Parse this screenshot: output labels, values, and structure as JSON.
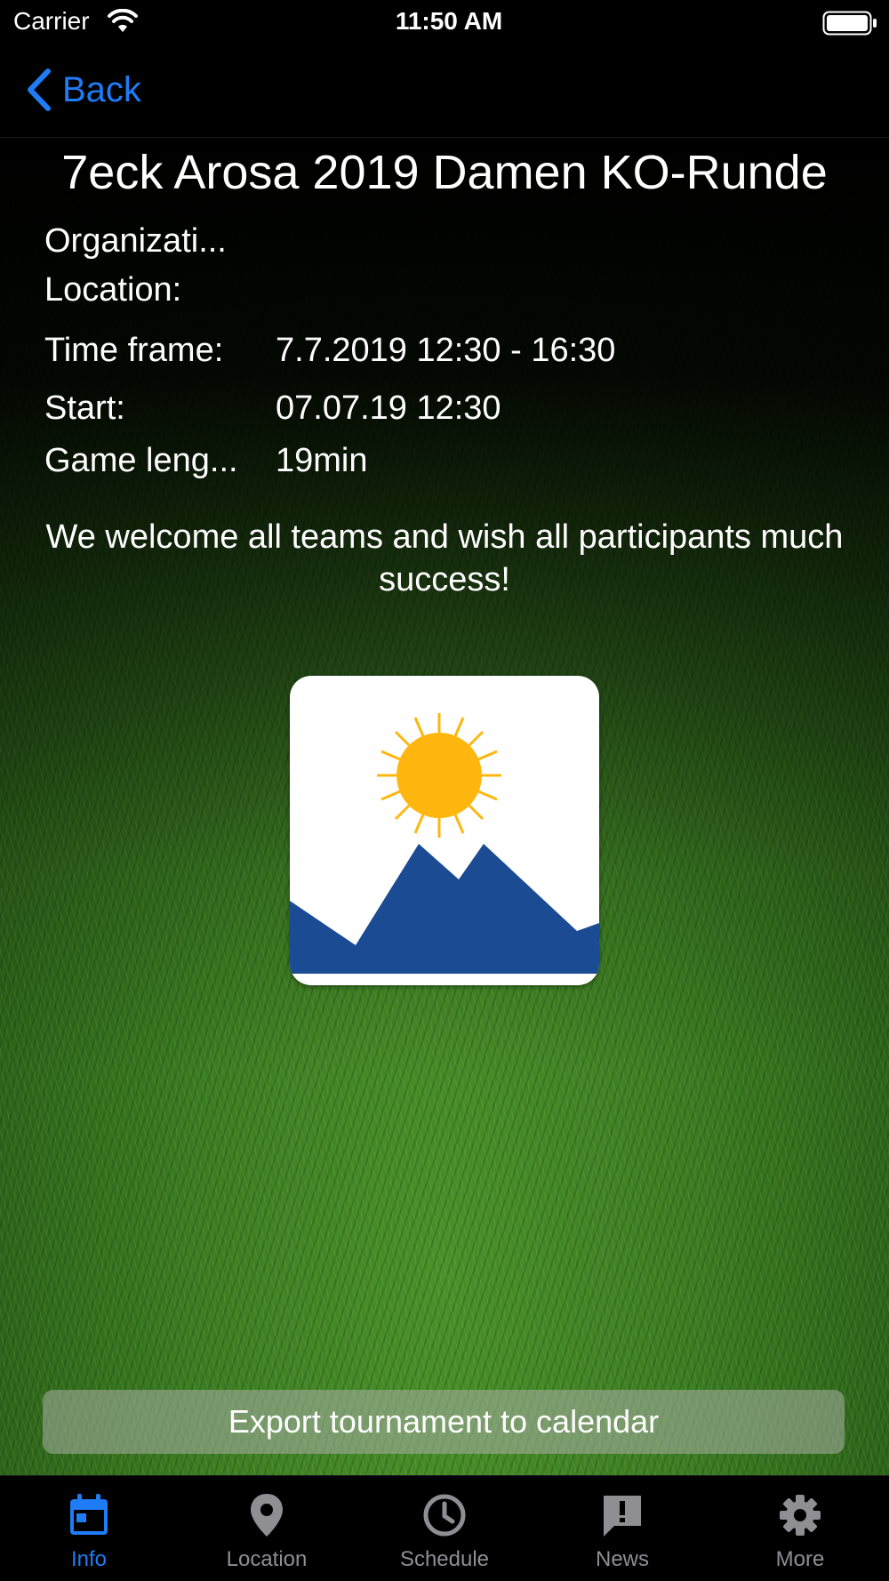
{
  "status_bar": {
    "carrier": "Carrier",
    "time": "11:50 AM"
  },
  "nav": {
    "back_label": "Back"
  },
  "tournament": {
    "title": "7eck Arosa 2019 Damen KO-Runde",
    "organization_label": "Organizati...",
    "location_label": "Location:",
    "timeframe_label": "Time frame:",
    "timeframe_value": "7.7.2019 12:30 - 16:30",
    "start_label": "Start:",
    "start_value": "07.07.19 12:30",
    "game_length_label": "Game leng...",
    "game_length_value": "19min",
    "welcome_text": "We welcome all teams and wish all participants much success!"
  },
  "export_label": "Export tournament to calendar",
  "tabs": [
    {
      "label": "Info",
      "icon": "calendar-icon",
      "active": true
    },
    {
      "label": "Location",
      "icon": "location-pin-icon",
      "active": false
    },
    {
      "label": "Schedule",
      "icon": "clock-icon",
      "active": false
    },
    {
      "label": "News",
      "icon": "news-icon",
      "active": false
    },
    {
      "label": "More",
      "icon": "gear-icon",
      "active": false
    }
  ],
  "colors": {
    "accent": "#1e7cf6",
    "inactive_tab": "#8e8e93",
    "logo_mountain": "#1b4b93",
    "logo_sun": "#ffb70f"
  }
}
